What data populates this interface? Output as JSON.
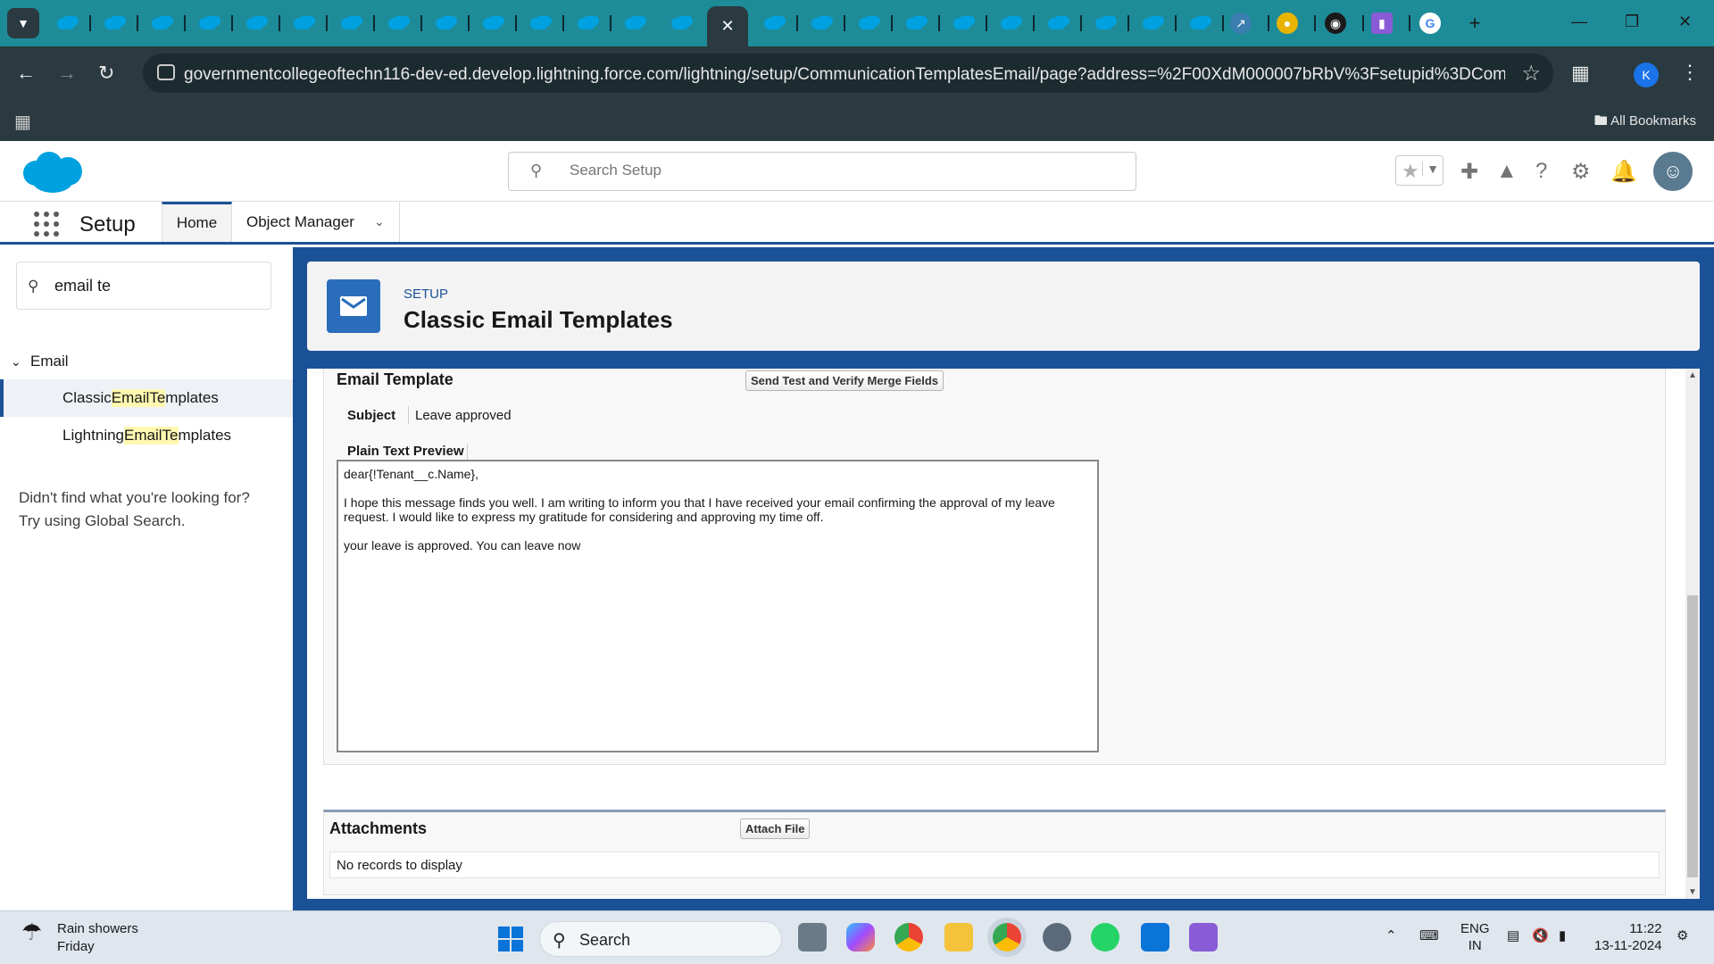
{
  "browser": {
    "url": "governmentcollegeoftechn116-dev-ed.develop.lightning.force.com/lightning/setup/CommunicationTemplatesEmail/page?address=%2F00XdM000007bRbV%3Fsetupid%3DCommu...",
    "profile_initial": "K",
    "bookmarks_label": "All Bookmarks"
  },
  "header": {
    "search_placeholder": "Search Setup"
  },
  "nav": {
    "app_name": "Setup",
    "home_tab": "Home",
    "object_manager_tab": "Object Manager"
  },
  "sidebar": {
    "quick_find_value": "email te",
    "group_label": "Email",
    "items": [
      {
        "pre": "Classic ",
        "hl1": "Email",
        "mid": " ",
        "hl2": "Te",
        "post": "mplates",
        "active": true
      },
      {
        "pre": "Lightning ",
        "hl1": "Email",
        "mid": " ",
        "hl2": "Te",
        "post": "mplates",
        "active": false
      }
    ],
    "not_found_line1": "Didn't find what you're looking for?",
    "not_found_line2": "Try using Global Search."
  },
  "page_header": {
    "eyebrow": "SETUP",
    "title": "Classic Email Templates"
  },
  "email_template": {
    "section_title": "Email Template",
    "send_test_button": "Send Test and Verify Merge Fields",
    "subject_label": "Subject",
    "subject_value": "Leave approved",
    "plain_text_label": "Plain Text Preview",
    "body_greeting": "dear{!Tenant__c.Name},",
    "body_paragraph": "I hope this message finds you well. I am writing to inform you that I have received your email confirming the approval of my leave request. I would like to express my gratitude for considering and approving my time off.",
    "body_closing": "your leave is approved. You can leave now"
  },
  "attachments": {
    "section_title": "Attachments",
    "attach_button": "Attach File",
    "empty_text": "No records to display"
  },
  "taskbar": {
    "weather_title": "Rain showers",
    "weather_day": "Friday",
    "search_label": "Search",
    "lang_line1": "ENG",
    "lang_line2": "IN",
    "time": "11:22",
    "date": "13-11-2024"
  }
}
